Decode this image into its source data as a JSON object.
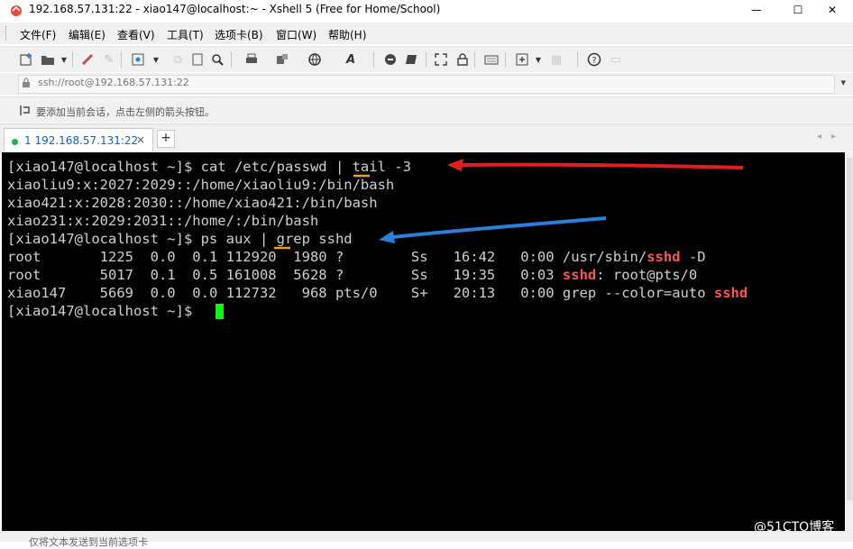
{
  "window": {
    "title": "192.168.57.131:22 - xiao147@localhost:~ - Xshell 5 (Free for Home/School)",
    "minimize": "—",
    "maximize": "☐",
    "close": "✕"
  },
  "menu": [
    "文件(F)",
    "编辑(E)",
    "查看(V)",
    "工具(T)",
    "选项卡(B)",
    "窗口(W)",
    "帮助(H)"
  ],
  "address": {
    "text": "ssh://root@192.168.57.131:22",
    "arrow": "▾"
  },
  "hint": {
    "text": "要添加当前会话，点击左侧的箭头按钮。"
  },
  "tabs": [
    {
      "label": "1 192.168.57.131:22",
      "close": "×"
    }
  ],
  "new_tab": "+",
  "terminal": {
    "lines": [
      "[xiao147@localhost ~]$ cat /etc/passwd | tail -3",
      "xiaoliu9:x:2027:2029::/home/xiaoliu9:/bin/bash",
      "xiao421:x:2028:2030::/home/xiao421:/bin/bash",
      "xiao231:x:2029:2031::/home/:/bin/bash",
      "[xiao147@localhost ~]$ ps aux | grep sshd"
    ],
    "ps_rows": [
      {
        "pre": "root       1225  0.0  0.1 112920  1980 ?        Ss   16:42   0:00 /usr/sbin/",
        "hl": "sshd",
        "post": " -D"
      },
      {
        "pre": "root       5017  0.1  0.5 161008  5628 ?        Ss   19:35   0:03 ",
        "hl": "sshd",
        "post": ": root@pts/0"
      },
      {
        "pre": "xiao147    5669  0.0  0.0 112732   968 pts/0    S+   20:13   0:00 grep --color=auto ",
        "hl": "sshd",
        "post": ""
      }
    ],
    "prompt": "[xiao147@localhost ~]$ "
  },
  "status": {
    "text": "仅将文本发送到当前选项卡"
  },
  "watermark": "@51CTO博客",
  "colors": {
    "terminal_bg": "#000000",
    "terminal_fg": "#cfcfcf",
    "highlight": "#ff5555",
    "cursor": "#00ff00",
    "arrow_red": "#e02020",
    "arrow_blue": "#2a7fd8",
    "underline_orange": "#f0a020"
  }
}
